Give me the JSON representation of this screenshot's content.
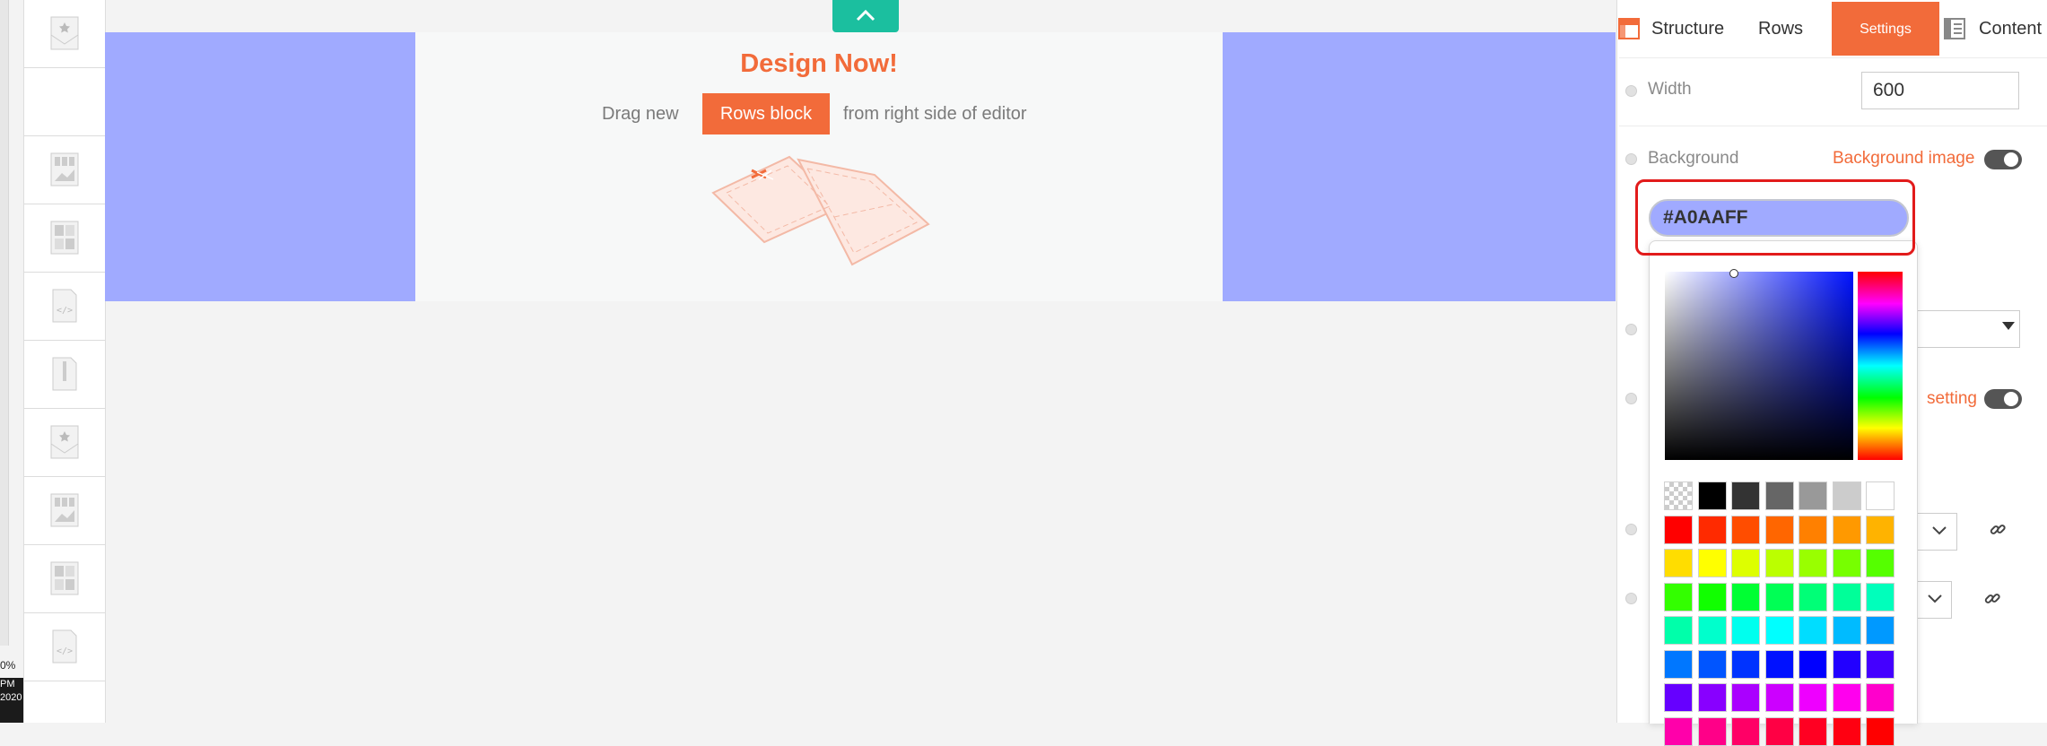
{
  "taskbar": {
    "zoom": "0%",
    "time": "PM",
    "year": "2020"
  },
  "canvas": {
    "row_color": "#A0AAFF",
    "title": "Design Now!",
    "drag_text": "Drag new",
    "rows_block_button": "Rows block",
    "from_text": "from right side of editor"
  },
  "tabs": [
    {
      "label": "Structure",
      "icon": "structure-icon"
    },
    {
      "label": "Rows"
    },
    {
      "label": "Settings",
      "active": true
    },
    {
      "label": "Content",
      "icon": "content-icon"
    }
  ],
  "settings": {
    "width_label": "Width",
    "width_value": "600",
    "background_label": "Background",
    "background_image_label": "Background image",
    "background_color": "#A0AAFF",
    "setting_partial_label": "setting"
  },
  "colors": {
    "accent": "#F26B3A",
    "teal": "#1BBF9F",
    "highlight": "#E21B1B"
  }
}
